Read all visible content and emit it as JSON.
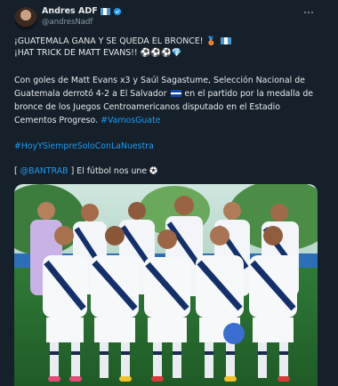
{
  "author": {
    "name": "Andres ADF",
    "handle": "@andresNadf",
    "verified": true
  },
  "tweet": {
    "headline1": "¡GUATEMALA GANA Y SE QUEDA EL BRONCE! 🥉",
    "headline2": "¡HAT TRICK DE MATT EVANS!! ⚽⚽⚽💎",
    "body_lines": [
      "Con goles de Matt Evans x3 y Saúl Sagastume, Selección Nacional de",
      "Guatemala derrotó 4-2 a El Salvador",
      "en el partido por la medalla de",
      "bronce de los Juegos Centroamericanos disputado en el Estadio",
      "Cementos Progreso."
    ],
    "hashtag1": "#VamosGuate",
    "hashtag2": "#HoyYSiempreSoloConLaNuestra",
    "mention": "@BANTRAB",
    "tail_open": "[ ",
    "tail_text": " ] El fútbol nos une"
  },
  "icons": {
    "more": "more-options-icon",
    "verified": "verified-badge-icon",
    "flag": "guatemala-flag-icon",
    "flag_sv": "el-salvador-flag-icon",
    "ball": "soccer-ball-icon"
  },
  "colors": {
    "background": "#15202b",
    "text": "#e7e9ea",
    "muted": "#8b98a5",
    "link": "#1d9bf0",
    "guatemala_blue": "#4997d0",
    "el_salvador_blue": "#0f47af"
  },
  "media": {
    "type": "team-photo",
    "description_icon": "team-photo-image"
  }
}
